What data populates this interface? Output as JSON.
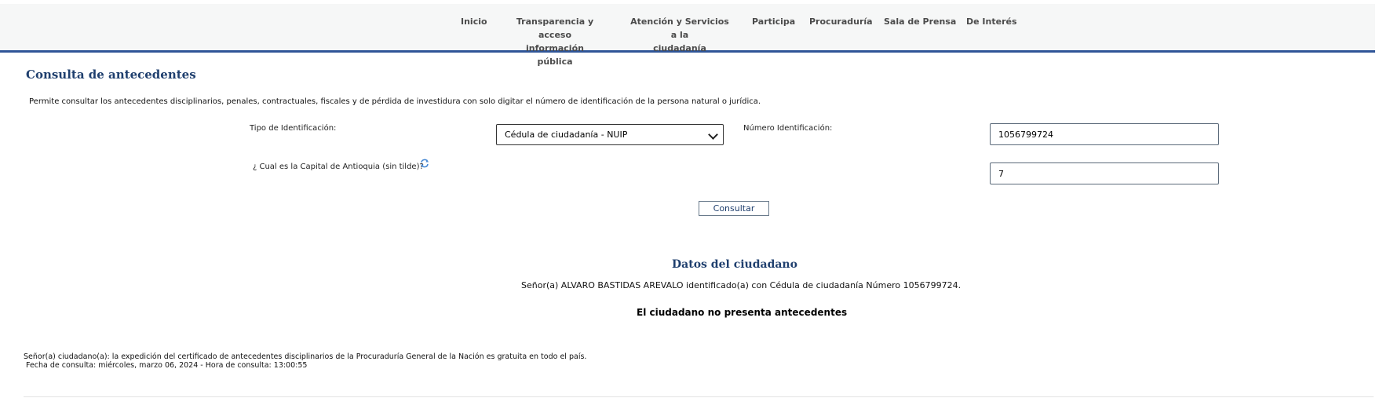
{
  "nav": {
    "items": [
      {
        "line1": "Inicio",
        "line2": ""
      },
      {
        "line1": "Transparencia y acceso",
        "line2": "información pública"
      },
      {
        "line1": "Atención y Servicios a la",
        "line2": "ciudadanía"
      },
      {
        "line1": "Participa",
        "line2": ""
      },
      {
        "line1": "Procuraduría",
        "line2": ""
      },
      {
        "line1": "Sala de Prensa",
        "line2": ""
      },
      {
        "line1": "De Interés",
        "line2": ""
      }
    ]
  },
  "main": {
    "title": "Consulta de antecedentes",
    "intro": "Permite consultar los antecedentes disciplinarios, penales, contractuales, fiscales y de pérdida de investidura con solo digitar el número de identificación de la persona natural o jurídica."
  },
  "form": {
    "tipo_label": "Tipo de Identificación:",
    "tipo_value": "Cédula de ciudadanía - NUIP",
    "numero_label": "Número Identificación:",
    "numero_value": "1056799724",
    "question_label": "¿ Cual es la Capital de Antioquia (sin tilde)?",
    "answer_value": "7",
    "submit_label": "Consultar"
  },
  "result": {
    "section_title": "Datos del ciudadano",
    "citizen_line": "Señor(a)  ALVARO  BASTIDAS AREVALO identificado(a) con Cédula de ciudadanía Número 1056799724.",
    "status": "El ciudadano no presenta antecedentes"
  },
  "footer": {
    "note_line1": "Señor(a) ciudadano(a): la expedición del certificado de antecedentes disciplinarios de la Procuraduría General de la Nación es gratuita en todo el país.",
    "note_line2": " Fecha de consulta: miércoles, marzo 06, 2024 - Hora de consulta: 13:00:55"
  },
  "colors": {
    "accent": "#2f5597",
    "title": "#1f3f6e",
    "nav_bg": "#f6f7f7"
  }
}
